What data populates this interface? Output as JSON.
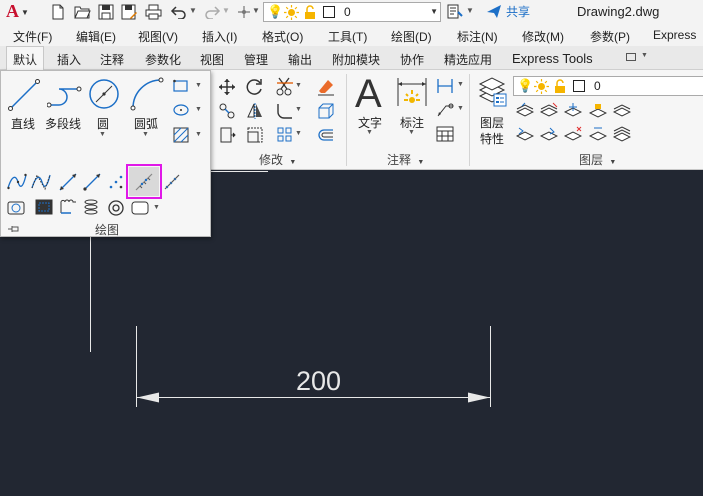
{
  "titlebar": {
    "app_logo": "A",
    "layer_value": "0",
    "share_label": "共享",
    "document_title": "Drawing2.dwg"
  },
  "menu": {
    "items": [
      "文件(F)",
      "编辑(E)",
      "视图(V)",
      "插入(I)",
      "格式(O)",
      "工具(T)",
      "绘图(D)",
      "标注(N)",
      "修改(M)",
      "参数(P)",
      "Express"
    ]
  },
  "tabs": {
    "items": [
      "默认",
      "插入",
      "注释",
      "参数化",
      "视图",
      "管理",
      "输出",
      "附加模块",
      "协作",
      "精选应用",
      "Express Tools"
    ],
    "active": "默认"
  },
  "ribbon": {
    "draw": {
      "line_label": "直线",
      "polyline_label": "多段线",
      "circle_label": "圆",
      "arc_label": "圆弧",
      "panel_title": "绘图"
    },
    "modify": {
      "panel_title": "修改"
    },
    "annotation": {
      "text_label": "文字",
      "dimension_label": "标注",
      "panel_title": "注释"
    },
    "layers": {
      "properties_label_1": "图层",
      "properties_label_2": "特性",
      "layer_value": "0",
      "panel_title": "图层"
    }
  },
  "drawing": {
    "dimension_value": "200"
  },
  "colors": {
    "canvas": "#222732",
    "highlight": "#e018e8",
    "accent_blue": "#1c6fc7",
    "logo_red": "#c8102e"
  }
}
